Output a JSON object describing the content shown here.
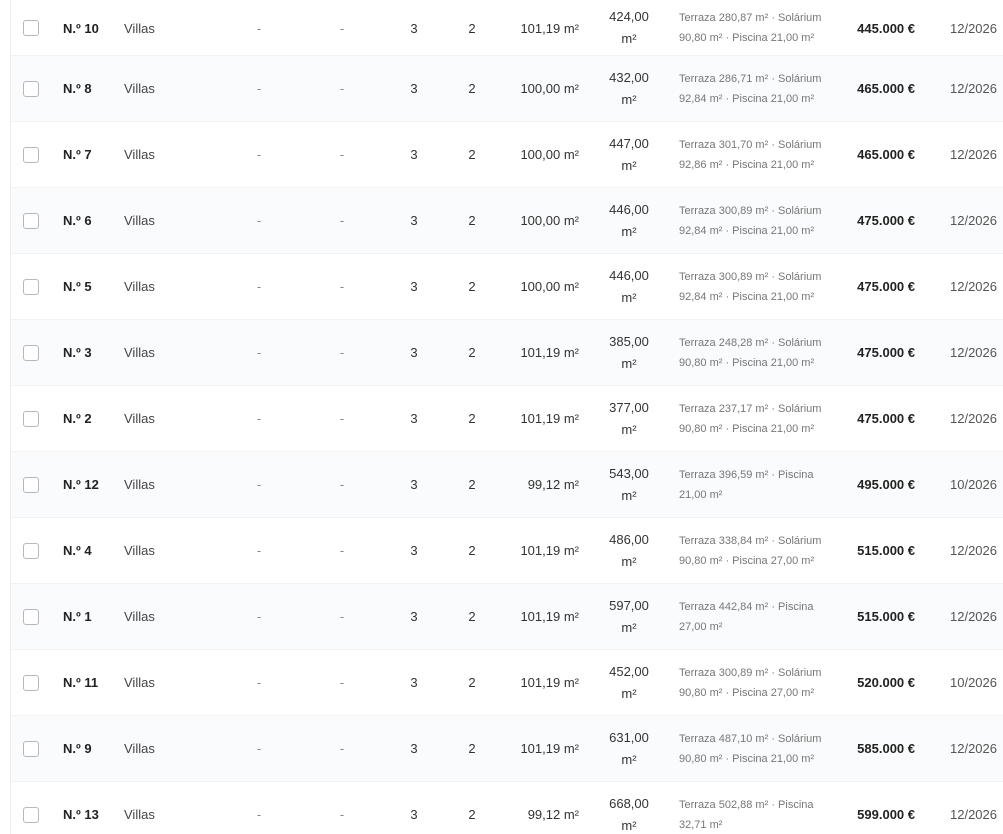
{
  "table": {
    "rows": [
      {
        "num": "N.º 10",
        "type": "Villas",
        "col_a": "-",
        "col_b": "-",
        "beds": "3",
        "baths": "2",
        "area": "101,19 m²",
        "plot": "424,00 m²",
        "extras": "Terraza 280,87 m² · Solárium 90,80 m² · Piscina 21,00 m²",
        "price": "445.000 €",
        "date": "12/2026"
      },
      {
        "num": "N.º 8",
        "type": "Villas",
        "col_a": "-",
        "col_b": "-",
        "beds": "3",
        "baths": "2",
        "area": "100,00 m²",
        "plot": "432,00 m²",
        "extras": "Terraza 286,71 m² · Solárium 92,84 m² · Piscina 21,00 m²",
        "price": "465.000 €",
        "date": "12/2026"
      },
      {
        "num": "N.º 7",
        "type": "Villas",
        "col_a": "-",
        "col_b": "-",
        "beds": "3",
        "baths": "2",
        "area": "100,00 m²",
        "plot": "447,00 m²",
        "extras": "Terraza 301,70 m² · Solárium 92,86 m² · Piscina 21,00 m²",
        "price": "465.000 €",
        "date": "12/2026"
      },
      {
        "num": "N.º 6",
        "type": "Villas",
        "col_a": "-",
        "col_b": "-",
        "beds": "3",
        "baths": "2",
        "area": "100,00 m²",
        "plot": "446,00 m²",
        "extras": "Terraza 300,89 m² · Solárium 92,84 m² · Piscina 21,00 m²",
        "price": "475.000 €",
        "date": "12/2026"
      },
      {
        "num": "N.º 5",
        "type": "Villas",
        "col_a": "-",
        "col_b": "-",
        "beds": "3",
        "baths": "2",
        "area": "100,00 m²",
        "plot": "446,00 m²",
        "extras": "Terraza 300,89 m² · Solárium 92,84 m² · Piscina 21,00 m²",
        "price": "475.000 €",
        "date": "12/2026"
      },
      {
        "num": "N.º 3",
        "type": "Villas",
        "col_a": "-",
        "col_b": "-",
        "beds": "3",
        "baths": "2",
        "area": "101,19 m²",
        "plot": "385,00 m²",
        "extras": "Terraza 248,28 m² · Solárium 90,80 m² · Piscina 21,00 m²",
        "price": "475.000 €",
        "date": "12/2026"
      },
      {
        "num": "N.º 2",
        "type": "Villas",
        "col_a": "-",
        "col_b": "-",
        "beds": "3",
        "baths": "2",
        "area": "101,19 m²",
        "plot": "377,00 m²",
        "extras": "Terraza 237,17 m² · Solárium 90,80 m² · Piscina 21,00 m²",
        "price": "475.000 €",
        "date": "12/2026"
      },
      {
        "num": "N.º 12",
        "type": "Villas",
        "col_a": "-",
        "col_b": "-",
        "beds": "3",
        "baths": "2",
        "area": "99,12 m²",
        "plot": "543,00 m²",
        "extras": "Terraza 396,59 m² · Piscina 21,00 m²",
        "price": "495.000 €",
        "date": "10/2026"
      },
      {
        "num": "N.º 4",
        "type": "Villas",
        "col_a": "-",
        "col_b": "-",
        "beds": "3",
        "baths": "2",
        "area": "101,19 m²",
        "plot": "486,00 m²",
        "extras": "Terraza 338,84 m² · Solárium 90,80 m² · Piscina 27,00 m²",
        "price": "515.000 €",
        "date": "12/2026"
      },
      {
        "num": "N.º 1",
        "type": "Villas",
        "col_a": "-",
        "col_b": "-",
        "beds": "3",
        "baths": "2",
        "area": "101,19 m²",
        "plot": "597,00 m²",
        "extras": "Terraza 442,84 m² · Piscina 27,00 m²",
        "price": "515.000 €",
        "date": "12/2026"
      },
      {
        "num": "N.º 11",
        "type": "Villas",
        "col_a": "-",
        "col_b": "-",
        "beds": "3",
        "baths": "2",
        "area": "101,19 m²",
        "plot": "452,00 m²",
        "extras": "Terraza 300,89 m² · Solárium 90,80 m² · Piscina 27,00 m²",
        "price": "520.000 €",
        "date": "10/2026"
      },
      {
        "num": "N.º 9",
        "type": "Villas",
        "col_a": "-",
        "col_b": "-",
        "beds": "3",
        "baths": "2",
        "area": "101,19 m²",
        "plot": "631,00 m²",
        "extras": "Terraza 487,10 m² · Solárium 90,80 m² · Piscina 21,00 m²",
        "price": "585.000 €",
        "date": "12/2026"
      },
      {
        "num": "N.º 13",
        "type": "Villas",
        "col_a": "-",
        "col_b": "-",
        "beds": "3",
        "baths": "2",
        "area": "99,12 m²",
        "plot": "668,00 m²",
        "extras": "Terraza 502,88 m² · Piscina 32,71 m²",
        "price": "599.000 €",
        "date": "12/2026"
      }
    ]
  }
}
